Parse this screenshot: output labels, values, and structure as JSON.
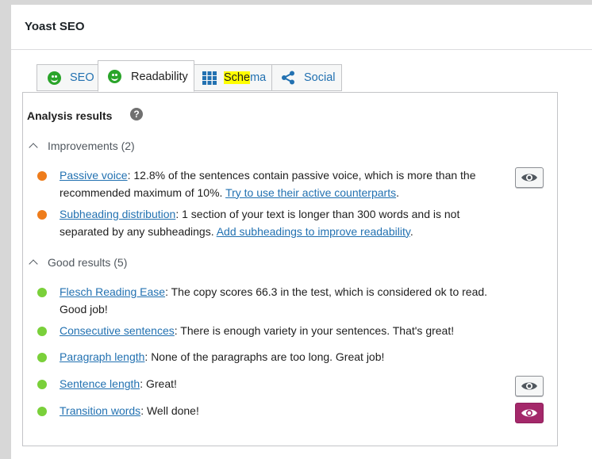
{
  "panel": {
    "title": "Yoast SEO"
  },
  "tabs": [
    {
      "label": "SEO",
      "icon": "smiley-icon"
    },
    {
      "label": "Readability",
      "icon": "smiley-icon"
    },
    {
      "label": "Schema",
      "label_highlight": "Sche",
      "label_rest": "ma",
      "icon": "grid-icon"
    },
    {
      "label": "Social",
      "icon": "share-icon"
    }
  ],
  "analysis": {
    "title": "Analysis results",
    "help_label": "?",
    "improvements": {
      "heading": "Improvements (2)",
      "items": [
        {
          "link": "Passive voice",
          "text": ": 12.8% of the sentences contain passive voice, which is more than the recommended maximum of 10%. ",
          "action": "Try to use their active counterparts",
          "end": ".",
          "status_color": "#ee7c1b"
        },
        {
          "link": "Subheading distribution",
          "text": ": 1 section of your text is longer than 300 words and is not separated by any subheadings. ",
          "action": "Add subheadings to improve readability",
          "end": ".",
          "status_color": "#ee7c1b"
        }
      ]
    },
    "good": {
      "heading": "Good results (5)",
      "items": [
        {
          "link": "Flesch Reading Ease",
          "text": ": The copy scores 66.3 in the test, which is considered ok to read. Good job!",
          "status_color": "#7ad03a"
        },
        {
          "link": "Consecutive sentences",
          "text": ": There is enough variety in your sentences. That's great!",
          "status_color": "#7ad03a"
        },
        {
          "link": "Paragraph length",
          "text": ": None of the paragraphs are too long. Great job!",
          "status_color": "#7ad03a"
        },
        {
          "link": "Sentence length",
          "text": ": Great!",
          "status_color": "#7ad03a"
        },
        {
          "link": "Transition words",
          "text": ": Well done!",
          "status_color": "#7ad03a"
        }
      ]
    }
  },
  "colors": {
    "accent": "#a4286a",
    "link": "#2271b1",
    "highlight": "#ffff00"
  }
}
